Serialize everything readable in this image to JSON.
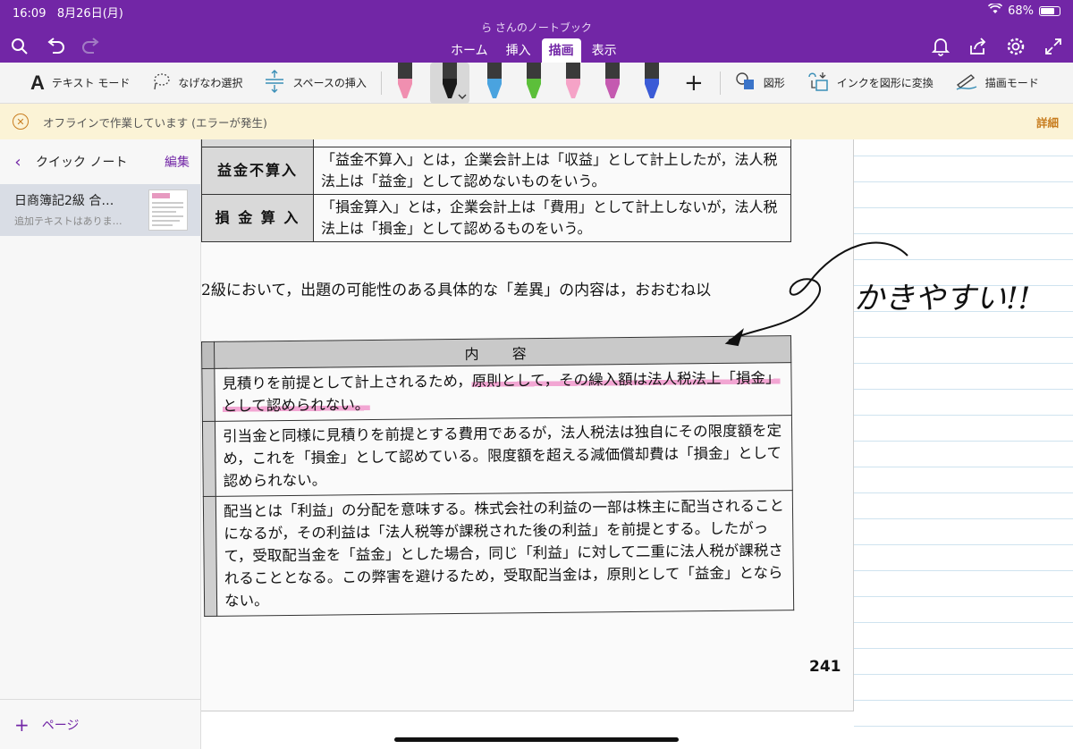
{
  "status": {
    "time": "16:09",
    "date": "8月26日(月)",
    "battery": "68%",
    "battery_level": 0.68
  },
  "notebook_title": "ら さんのノートブック",
  "tabs": [
    {
      "label": "ホーム"
    },
    {
      "label": "挿入"
    },
    {
      "label": "描画"
    },
    {
      "label": "表示"
    }
  ],
  "active_tab": "描画",
  "ribbon": {
    "text_mode": "テキスト モード",
    "lasso": "なげなわ選択",
    "insert_space": "スペースの挿入",
    "shapes": "図形",
    "ink_to_shape": "インクを図形に変換",
    "draw_mode": "描画モード"
  },
  "pens": [
    {
      "name": "eraser-pen",
      "color": "#f08fb0"
    },
    {
      "name": "black-pen",
      "color": "#1a1a1a"
    },
    {
      "name": "blue-pen",
      "color": "#4aa3df"
    },
    {
      "name": "green-pen",
      "color": "#5cbf3a"
    },
    {
      "name": "pink-highlighter",
      "color": "#f5a3c7"
    },
    {
      "name": "rainbow-pen",
      "color": "#c45ab0"
    },
    {
      "name": "galaxy-pen",
      "color": "#3b5bd6"
    }
  ],
  "banner": {
    "message": "オフラインで作業しています (エラーが発生)",
    "detail": "詳細"
  },
  "sidebar": {
    "section": "クイック ノート",
    "edit": "編集",
    "pages": [
      {
        "title": "日商簿記2級 合…",
        "subtitle": "追加テキストはありま…"
      }
    ],
    "add_page": "ページ"
  },
  "document": {
    "table1": [
      {
        "head": "益金不算入",
        "body": "「益金不算入」とは，企業会計上は「収益」として計上したが，法人税法上は「益金」として認めないものをいう。"
      },
      {
        "head": "損 金 算 入",
        "body": "「損金算入」とは，企業会計上は「費用」として計上しないが，法人税法上は「損金」として認めるものをいう。"
      }
    ],
    "paragraph": "2級において，出題の可能性のある具体的な「差異」の内容は，おおむね以",
    "table2_header": "内 容",
    "table2": [
      {
        "pre": "見積りを前提として計上されるため，",
        "hl": "原則として，その繰入額は法人税法上「損金」として認められない。"
      },
      {
        "pre": "引当金と同様に見積りを前提とする費用であるが，法人税法は独自にその限度額を定め，これを「損金」として認めている。限度額を超える減価償却費は「損金」として認められない。",
        "hl": ""
      },
      {
        "pre": "配当とは「利益」の分配を意味する。株式会社の利益の一部は株主に配当されることになるが，その利益は「法人税等が課税された後の利益」を前提とする。したがって，受取配当金を「益金」とした場合，同じ「利益」に対して二重に法人税が課税されることとなる。この弊害を避けるため，受取配当金は，原則として「益金」とならない。",
        "hl": ""
      }
    ],
    "page_number": "241"
  },
  "handwriting": "かきやすい!!"
}
